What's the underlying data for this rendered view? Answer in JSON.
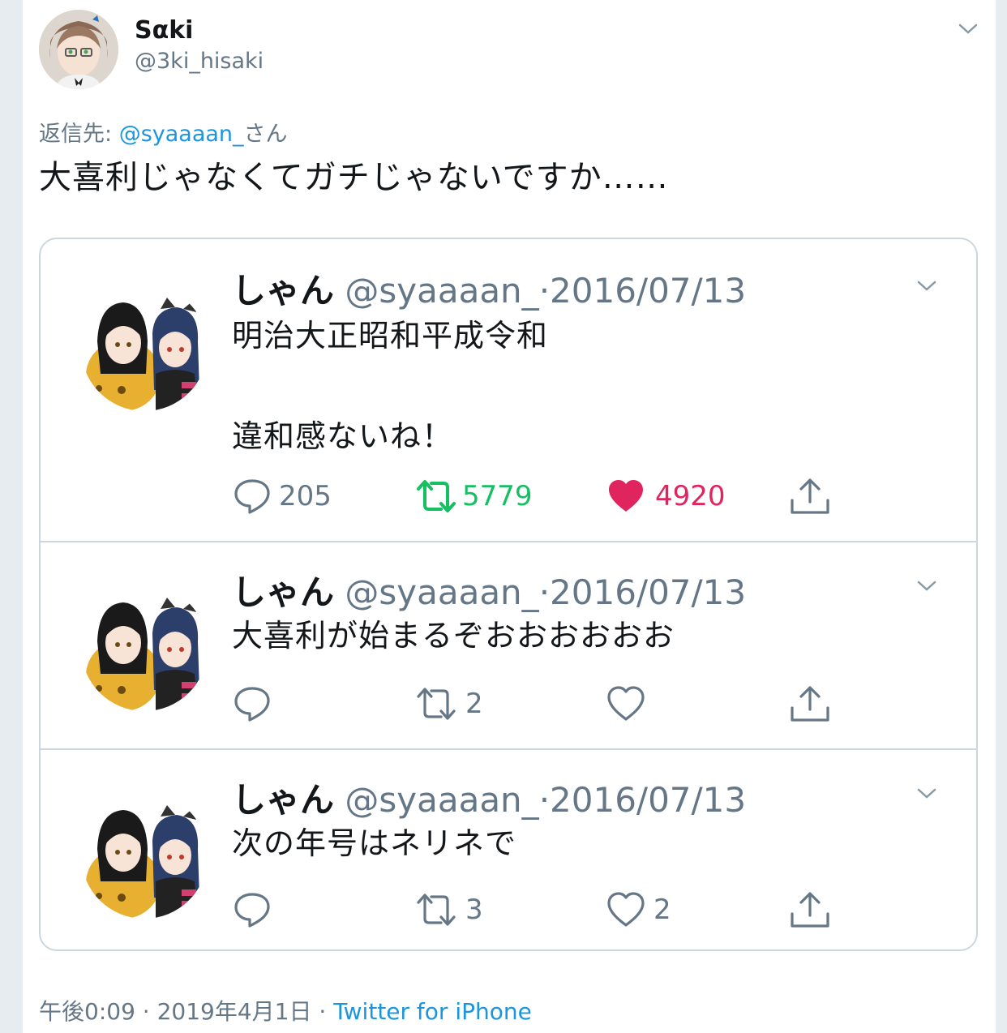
{
  "tweet": {
    "author_name": "Sαki",
    "author_handle": "@3ki_hisaki",
    "reply_label": "返信先: ",
    "reply_mention": "@syaaaan_",
    "reply_suffix": "さん",
    "text": "大喜利じゃなくてガチじゃないですか……",
    "time": "午後0:09",
    "dot1": " · ",
    "date": "2019年4月1日",
    "dot2": " · ",
    "source": "Twitter for iPhone"
  },
  "quoted_tweets": [
    {
      "name": "しゃん",
      "handle": "@syaaaan_",
      "sep": "·",
      "date": "2016/07/13",
      "text": "明治大正昭和平成令和\n\n違和感ないね！",
      "replies": "205",
      "retweets": "5779",
      "likes": "4920",
      "retweeted": true,
      "liked": true
    },
    {
      "name": "しゃん",
      "handle": "@syaaaan_",
      "sep": "·",
      "date": "2016/07/13",
      "text": "大喜利が始まるぞおおおおおお",
      "replies": "",
      "retweets": "2",
      "likes": "",
      "retweeted": false,
      "liked": false
    },
    {
      "name": "しゃん",
      "handle": "@syaaaan_",
      "sep": "·",
      "date": "2016/07/13",
      "text": "次の年号はネリネで",
      "replies": "",
      "retweets": "3",
      "likes": "2",
      "retweeted": false,
      "liked": false
    }
  ],
  "icons": {
    "reply": "reply-icon",
    "retweet": "retweet-icon",
    "like": "heart-icon",
    "share": "share-icon",
    "caret": "chevron-down-icon"
  },
  "colors": {
    "link": "#1b95e0",
    "retweet_active": "#17bf63",
    "like_active": "#e0245e",
    "secondary_text": "#657786",
    "border": "#ccd6dd"
  }
}
